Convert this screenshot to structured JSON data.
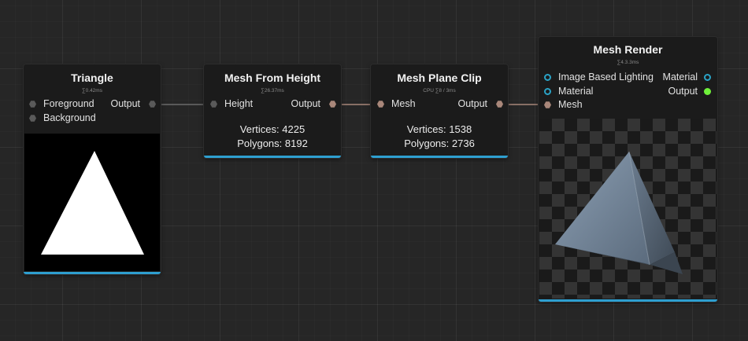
{
  "nodes": {
    "triangle": {
      "title": "Triangle",
      "timing": "∑0.42ms",
      "inputs": [
        "Foreground",
        "Background"
      ],
      "output": "Output"
    },
    "mesh_from_height": {
      "title": "Mesh From Height",
      "timing": "∑26.37ms",
      "input": "Height",
      "output": "Output",
      "vertices": "Vertices: 4225",
      "polygons": "Polygons: 8192"
    },
    "mesh_plane_clip": {
      "title": "Mesh Plane Clip",
      "timing": "CPU ∑8 / 3ms",
      "input": "Mesh",
      "output": "Output",
      "vertices": "Vertices: 1538",
      "polygons": "Polygons: 2736"
    },
    "mesh_render": {
      "title": "Mesh Render",
      "timing": "∑4.3.3ms",
      "inputs": [
        "Image Based Lighting",
        "Material",
        "Mesh"
      ],
      "outputs": [
        "Material",
        "Output"
      ]
    }
  },
  "colors": {
    "accent": "#2e9fd0",
    "port_grey": "#5a5a5a",
    "port_mesh": "#a9877a",
    "port_material": "#2aa3c6",
    "port_output_active": "#6ff03a",
    "wire_grey": "#6a6a6a",
    "wire_mesh": "#a9877a"
  },
  "icons": {
    "port_hex": "hexagon-port-icon",
    "port_ring": "ring-port-icon",
    "port_active": "filled-circle-port-icon"
  }
}
